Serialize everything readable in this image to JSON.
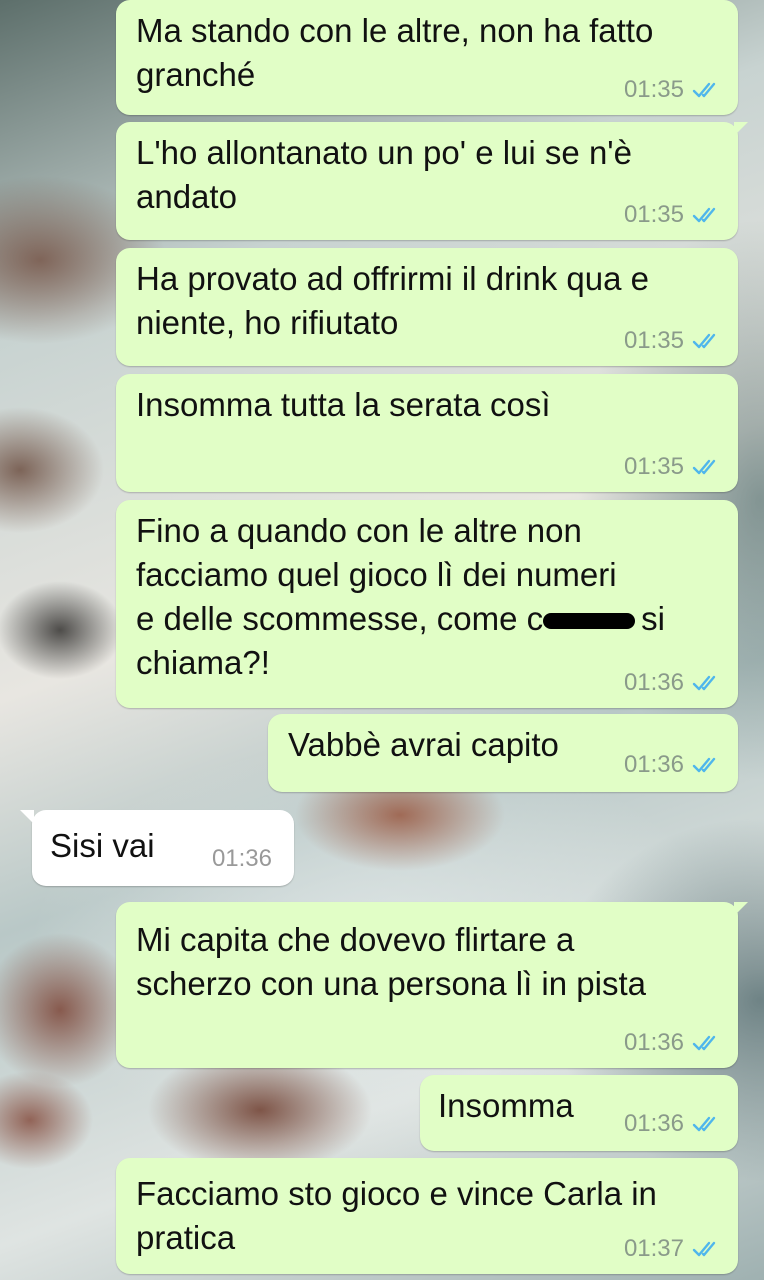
{
  "messages": [
    {
      "text": "Ma stando con le altre, non ha fatto\ngranché",
      "time": "01:35",
      "side": "out",
      "read": true
    },
    {
      "text": "L'ho allontanato un po' e lui se n'è\nandato",
      "time": "01:35",
      "side": "out",
      "read": true
    },
    {
      "text": "Ha provato ad offrirmi il drink qua e\nniente, ho rifiutato",
      "time": "01:35",
      "side": "out",
      "read": true
    },
    {
      "text": "Insomma tutta la serata così",
      "time": "01:35",
      "side": "out",
      "read": true
    },
    {
      "text_a": "Fino a quando con le altre non\nfacciamo quel gioco lì dei numeri\ne delle scommesse, come c",
      "text_b": "si\nchiama?!",
      "time": "01:36",
      "side": "out",
      "read": true,
      "redacted": true
    },
    {
      "text": "Vabbè avrai capito",
      "time": "01:36",
      "side": "out",
      "read": true
    },
    {
      "text": "Sisi vai",
      "time": "01:36",
      "side": "in"
    },
    {
      "text": "Mi capita che dovevo flirtare a\nscherzo con una persona lì in pista",
      "time": "01:36",
      "side": "out",
      "read": true
    },
    {
      "text": "Insomma",
      "time": "01:36",
      "side": "out",
      "read": true
    },
    {
      "text": "Facciamo sto gioco e vince Carla in\npratica",
      "time": "01:37",
      "side": "out",
      "read": true
    }
  ],
  "colors": {
    "outgoing_bubble": "#e1fec6",
    "incoming_bubble": "#ffffff",
    "read_tick": "#4fb6ec"
  },
  "icons": {
    "read_receipt": "double-check-icon"
  }
}
